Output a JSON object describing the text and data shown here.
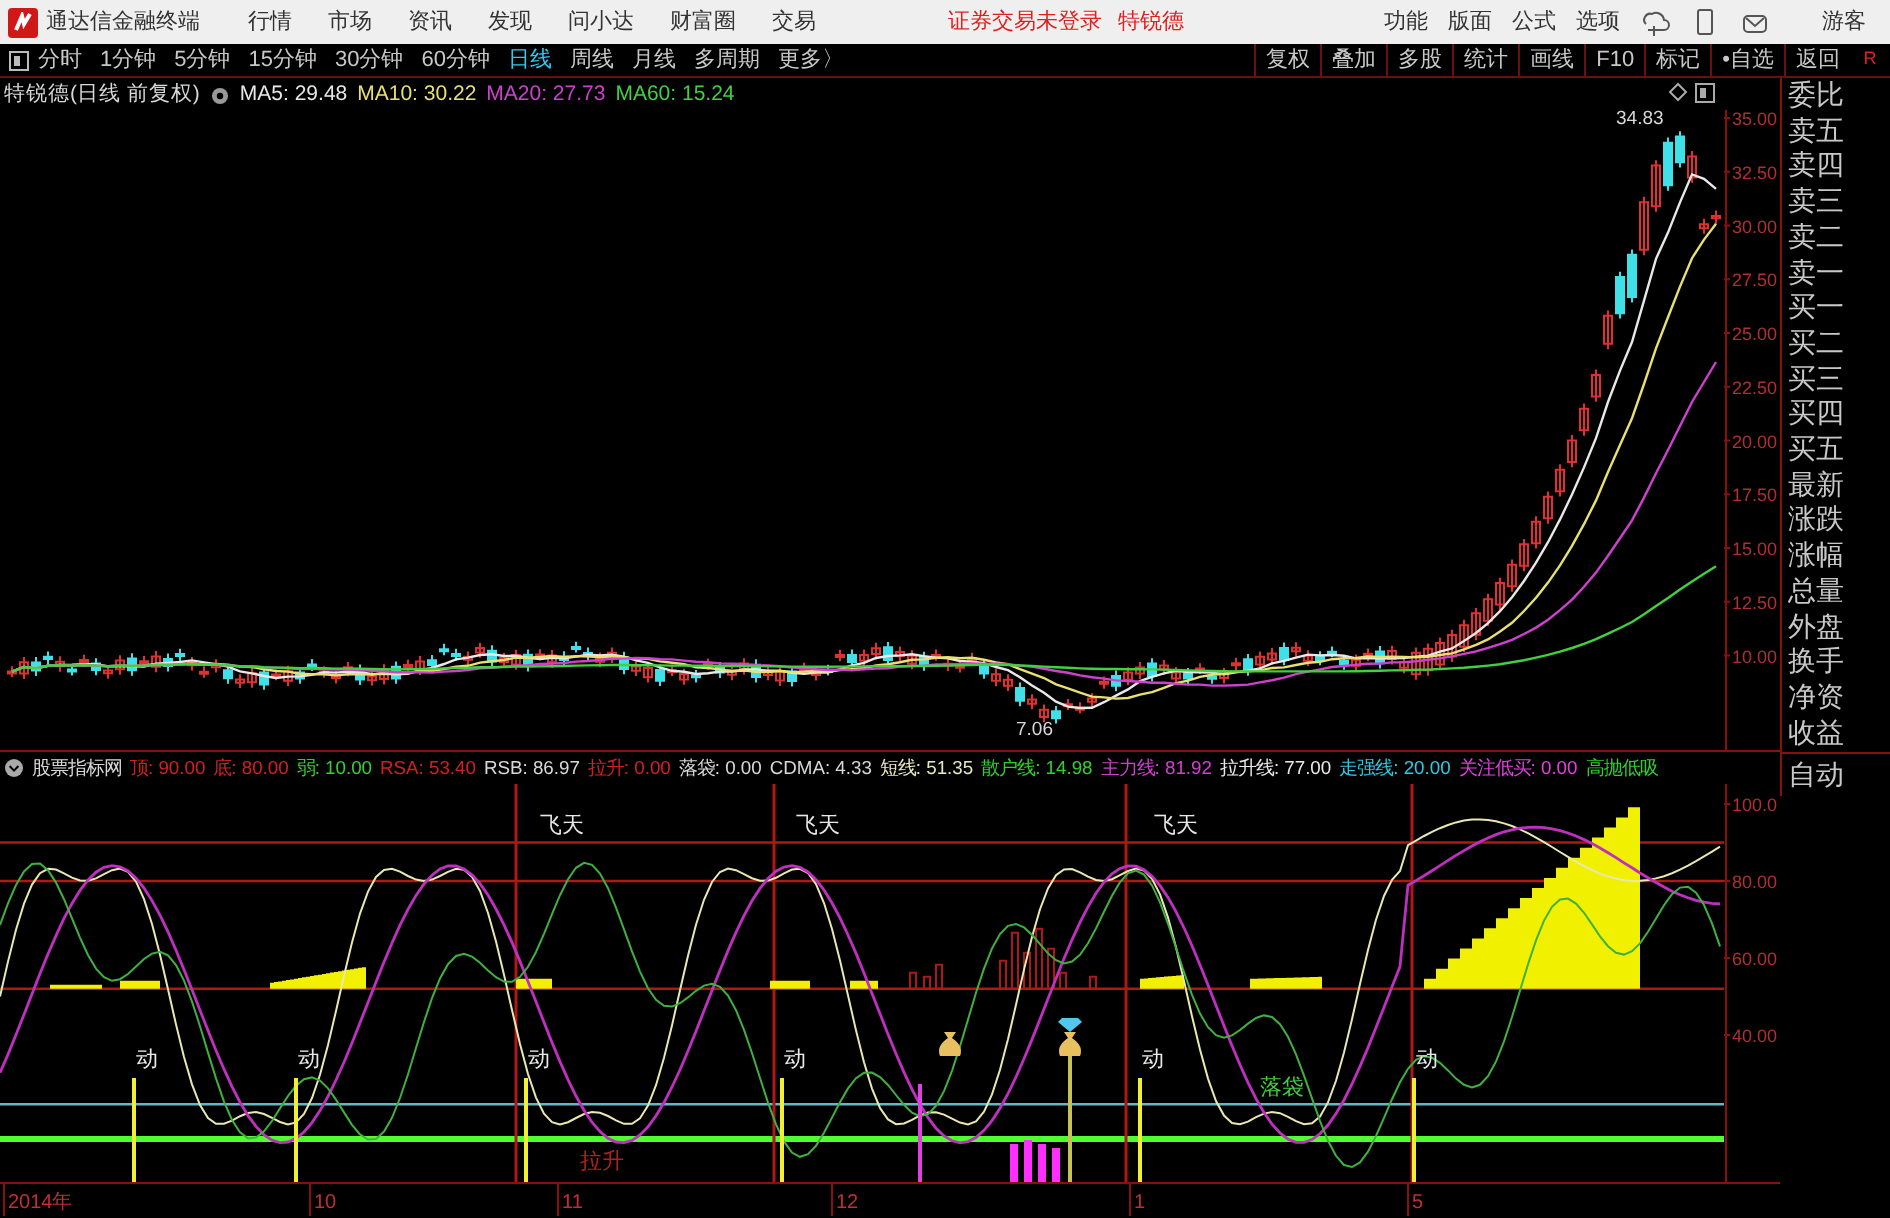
{
  "app": {
    "title": "通达信金融终端",
    "menu": [
      "行情",
      "市场",
      "资讯",
      "发现",
      "问小达",
      "财富圈",
      "交易"
    ],
    "login_notice": "证券交易未登录",
    "stock_name": "特锐德",
    "menu_right": [
      "功能",
      "版面",
      "公式",
      "选项"
    ],
    "user": "游客"
  },
  "periods": [
    {
      "label": "分时",
      "selected": false
    },
    {
      "label": "1分钟",
      "selected": false
    },
    {
      "label": "5分钟",
      "selected": false
    },
    {
      "label": "15分钟",
      "selected": false
    },
    {
      "label": "30分钟",
      "selected": false
    },
    {
      "label": "60分钟",
      "selected": false
    },
    {
      "label": "日线",
      "selected": true
    },
    {
      "label": "周线",
      "selected": false
    },
    {
      "label": "月线",
      "selected": false
    },
    {
      "label": "多周期",
      "selected": false
    },
    {
      "label": "更多〉",
      "selected": false
    }
  ],
  "tools": [
    "复权",
    "叠加",
    "多股",
    "统计",
    "画线",
    "F10",
    "标记",
    "•自选",
    "返回"
  ],
  "corner": "R",
  "price_chart": {
    "title": "特锐德(日线 前复权)",
    "legend": [
      {
        "label": "MA5: 29.48",
        "color": "#e8e8e8"
      },
      {
        "label": "MA10: 30.22",
        "color": "#e8e070"
      },
      {
        "label": "MA20: 27.73",
        "color": "#d040d0"
      },
      {
        "label": "MA60: 15.24",
        "color": "#40d040"
      }
    ],
    "axis": [
      "35.00",
      "32.50",
      "30.00",
      "27.50",
      "25.00",
      "22.50",
      "20.00",
      "17.50",
      "15.00",
      "12.50",
      "10.00"
    ],
    "high_label": "34.83",
    "low_label": "7.06"
  },
  "indicator": {
    "title": "股票指标网",
    "legend": [
      {
        "label": "顶: 90.00",
        "color": "#d02020"
      },
      {
        "label": "底: 80.00",
        "color": "#d02020"
      },
      {
        "label": "弱: 10.00",
        "color": "#30d030"
      },
      {
        "label": "RSA: 53.40",
        "color": "#d02020"
      },
      {
        "label": "RSB: 86.97",
        "color": "#d8d8d8"
      },
      {
        "label": "拉升: 0.00",
        "color": "#d02020"
      },
      {
        "label": "落袋: 0.00",
        "color": "#d8d8d8"
      },
      {
        "label": "CDMA: 4.33",
        "color": "#d8d8d8"
      },
      {
        "label": "短线: 51.35",
        "color": "#e8e8c0"
      },
      {
        "label": "散户线: 14.98",
        "color": "#30d030"
      },
      {
        "label": "主力线: 81.92",
        "color": "#d040d0"
      },
      {
        "label": "拉升线: 77.00",
        "color": "#e8e8e8"
      },
      {
        "label": "走强线: 20.00",
        "color": "#30c8e0"
      },
      {
        "label": "关注低买: 0.00",
        "color": "#e040e0"
      },
      {
        "label": "高抛低吸",
        "color": "#30d030"
      }
    ],
    "axis": [
      "100.0",
      "80.00",
      "60.00",
      "40.00"
    ],
    "signals": [
      {
        "text": "飞天",
        "kind": "top"
      },
      {
        "text": "飞天",
        "kind": "top"
      },
      {
        "text": "飞天",
        "kind": "top"
      },
      {
        "text": "动",
        "kind": "move"
      },
      {
        "text": "动",
        "kind": "move"
      },
      {
        "text": "动",
        "kind": "move"
      },
      {
        "text": "动",
        "kind": "move"
      },
      {
        "text": "动",
        "kind": "move"
      },
      {
        "text": "动",
        "kind": "move"
      },
      {
        "text": "拉升",
        "kind": "rise"
      },
      {
        "text": "落袋",
        "kind": "exit"
      }
    ]
  },
  "x_axis": [
    "2014年",
    "10",
    "11",
    "12",
    "1",
    "5"
  ],
  "sidebar": {
    "items": [
      "委比",
      "卖五",
      "卖四",
      "卖三",
      "卖二",
      "卖一",
      "买一",
      "买二",
      "买三",
      "买四",
      "买五",
      "最新",
      "涨跌",
      "涨幅",
      "总量",
      "外盘",
      "换手",
      "净资",
      "收益"
    ],
    "auto": "自动"
  }
}
